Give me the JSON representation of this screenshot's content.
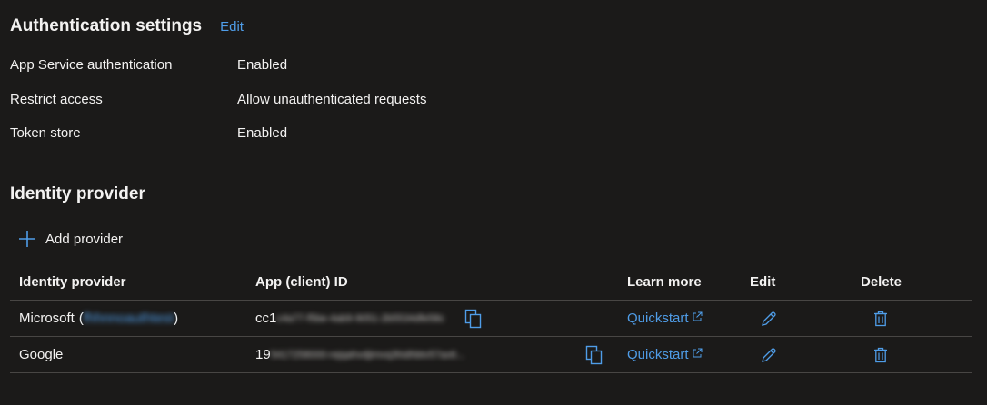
{
  "auth_settings": {
    "title": "Authentication settings",
    "edit_label": "Edit",
    "rows": [
      {
        "label": "App Service authentication",
        "value": "Enabled"
      },
      {
        "label": "Restrict access",
        "value": "Allow unauthenticated requests"
      },
      {
        "label": "Token store",
        "value": "Enabled"
      }
    ]
  },
  "identity": {
    "title": "Identity provider",
    "add_label": "Add provider",
    "columns": {
      "provider": "Identity provider",
      "client_id": "App (client) ID",
      "learn_more": "Learn more",
      "edit": "Edit",
      "delete": "Delete"
    },
    "providers": [
      {
        "name": "Microsoft",
        "open_paren": "(",
        "blurred_name": "fhhnnoauthtest",
        "close_paren": ")",
        "client_id_prefix": "cc1",
        "client_id_blurred": "c4a77-f5be-4ab9-9051-2b5534dfe58c",
        "learn_label": "Quickstart"
      },
      {
        "name": "Google",
        "client_id_prefix": "19",
        "client_id_blurred": "5417258000-rejqahvdjimvq3hidhbtv57ax6...",
        "learn_label": "Quickstart"
      }
    ]
  },
  "colors": {
    "background": "#1b1a19",
    "accent": "#4f9de8",
    "divider": "#484644"
  }
}
